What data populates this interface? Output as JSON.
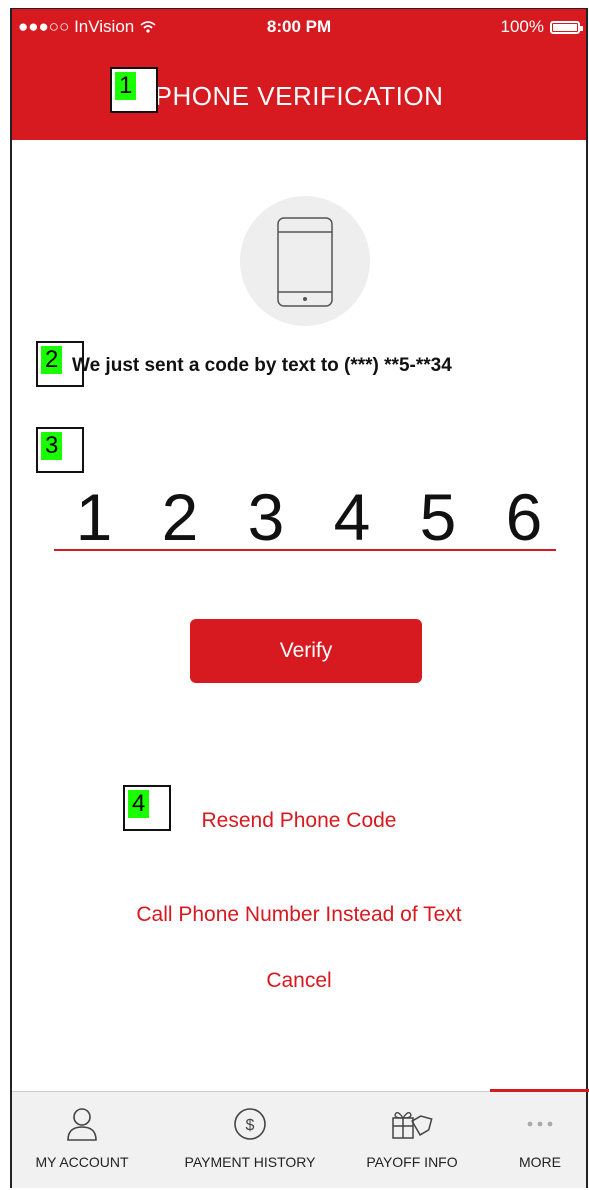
{
  "status_bar": {
    "carrier": "●●●○○ InVision",
    "wifi_icon": "wifi-icon",
    "time": "8:00 PM",
    "battery": "100%"
  },
  "header": {
    "title": "PHONE VERIFICATION"
  },
  "markers": [
    "1",
    "2",
    "3",
    "4"
  ],
  "message": "We just sent a code by text to (***) **5-**34",
  "code": [
    "1",
    "2",
    "3",
    "4",
    "5",
    "6"
  ],
  "verify_label": "Verify",
  "links": {
    "resend": "Resend Phone Code",
    "call": "Call Phone Number Instead of Text",
    "cancel": "Cancel"
  },
  "tabs": [
    {
      "label": "MY ACCOUNT",
      "icon": "person-icon"
    },
    {
      "label": "PAYMENT HISTORY",
      "icon": "dollar-coin-icon"
    },
    {
      "label": "PAYOFF INFO",
      "icon": "gift-tag-icon"
    },
    {
      "label": "MORE",
      "icon": "more-dots-icon"
    }
  ],
  "colors": {
    "accent": "#d71920",
    "highlight": "#1aff00"
  }
}
